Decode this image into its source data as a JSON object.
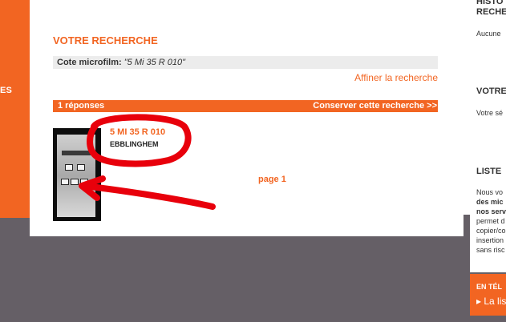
{
  "left_nav": {
    "label": "ES"
  },
  "main": {
    "section_title": "VOTRE RECHERCHE",
    "criteria": {
      "label": "Cote microfilm:",
      "value": "\"5 Mi 35 R 010\""
    },
    "refine_link": "Affiner la recherche",
    "results_bar": {
      "count": "1 réponses",
      "save_link": "Conserver cette recherche >>"
    },
    "result": {
      "code": "5 MI 35 R 010",
      "place": "EBBLINGHEM"
    },
    "pager": "page 1"
  },
  "sidebar": {
    "history": {
      "title_line1": "HISTO",
      "title_line2": "RECHE",
      "text": "Aucune"
    },
    "votre": {
      "title": "VOTRE",
      "text": "Votre sé"
    },
    "liste": {
      "title": "LISTE",
      "lines": [
        "Nous vo",
        "des mic",
        "nos serv",
        "permet d",
        "copier/co",
        "insertion",
        "sans risc"
      ],
      "bold_lines": [
        1,
        2
      ]
    },
    "telecharger": {
      "title": "EN TÉL",
      "link": "▸ La lis"
    }
  },
  "colors": {
    "accent": "#f26522",
    "band_gray": "#655f66",
    "annotation_red": "#e8000b"
  }
}
